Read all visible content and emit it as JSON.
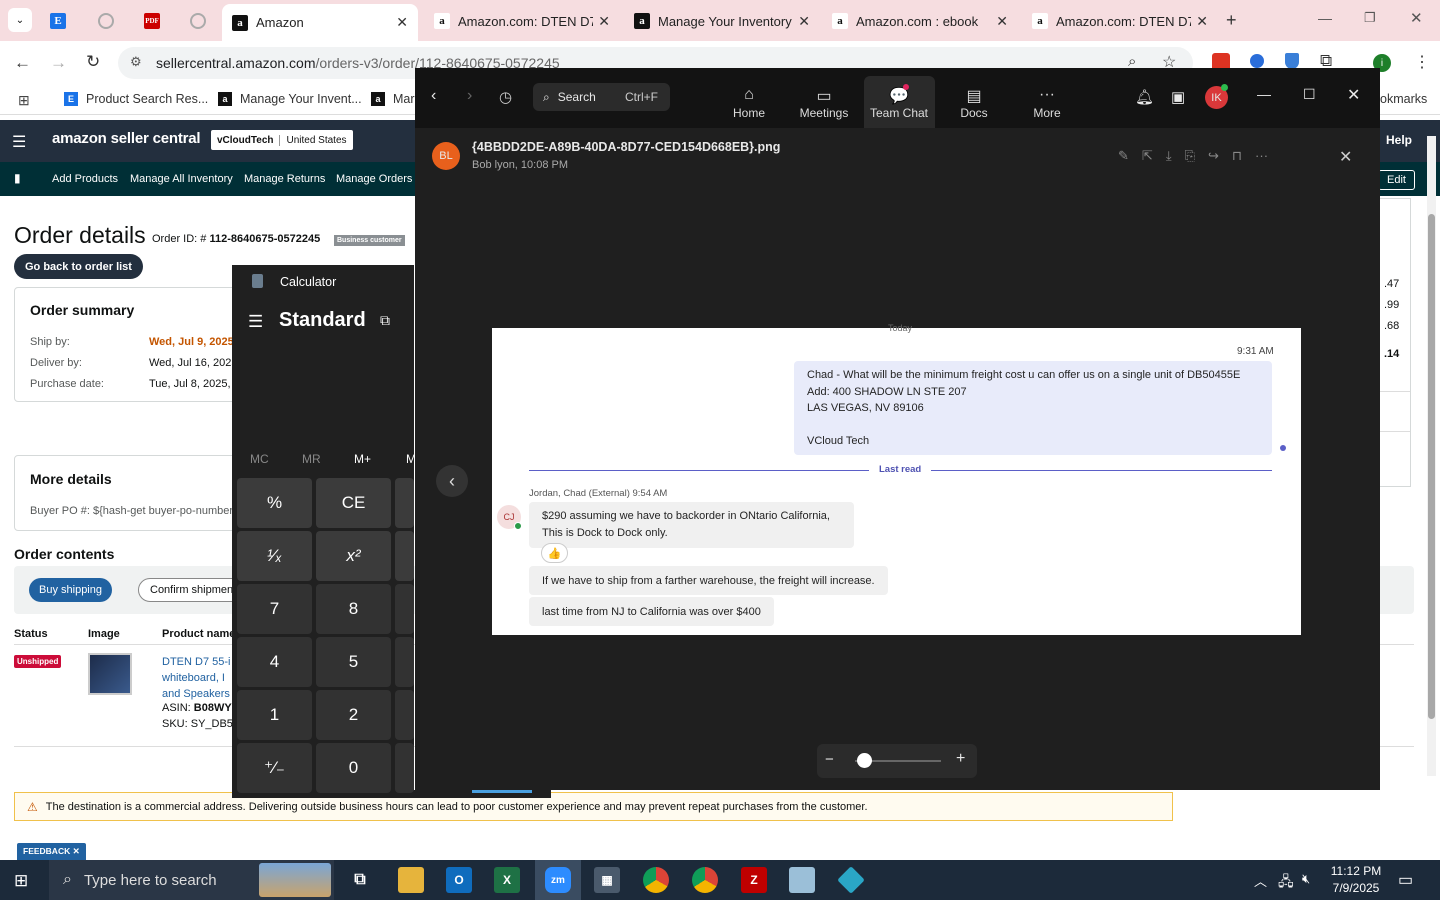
{
  "tabs": [
    {
      "label": "",
      "icon": "ec-icon"
    },
    {
      "label": "",
      "icon": "globe-icon"
    },
    {
      "label": "",
      "icon": "pdf-icon"
    },
    {
      "label": "",
      "icon": "globe-icon"
    },
    {
      "label": "Amazon",
      "icon": "amazon-icon"
    },
    {
      "label": "Amazon.com: DTEN D7 5",
      "icon": "amazon-icon"
    },
    {
      "label": "Manage Your Inventory",
      "icon": "amazon-icon"
    },
    {
      "label": "Amazon.com : ebook",
      "icon": "amazon-icon"
    },
    {
      "label": "Amazon.com: DTEN D7 5",
      "icon": "amazon-icon"
    }
  ],
  "address": {
    "host": "sellercentral.amazon.com",
    "path": "/orders-v3/order/112-8640675-0572245"
  },
  "bookmarks": [
    {
      "label": "Product Search Res..."
    },
    {
      "label": "Manage Your Invent..."
    },
    {
      "label": "Mar"
    },
    {
      "label": "okmarks"
    }
  ],
  "seller": {
    "logo": "amazon seller central",
    "account": "vCloudTech",
    "marketplace": "United States",
    "help": "Help",
    "edit": "Edit",
    "nav": [
      "Add Products",
      "Manage All Inventory",
      "Manage Returns",
      "Manage Orders"
    ],
    "order_title": "Order details",
    "order_id_label": "Order ID: #",
    "order_id": "112-8640675-0572245",
    "business_badge": "Business customer",
    "back_button": "Go back to order list",
    "summary_title": "Order summary",
    "ship_by_label": "Ship by:",
    "ship_by": "Wed, Jul 9, 2025",
    "deliver_by_label": "Deliver by:",
    "deliver_by": "Wed, Jul 16, 2025",
    "purchase_label": "Purchase date:",
    "purchase": "Tue, Jul 8, 2025,",
    "more_title": "More details",
    "buyer_po": "Buyer PO #: ${hash-get buyer-po-number}",
    "contents_title": "Order contents",
    "buy_shipping": "Buy shipping",
    "confirm_shipment": "Confirm shipment",
    "col_status": "Status",
    "col_image": "Image",
    "col_product": "Product name",
    "status_badge": "Unshipped",
    "product_line1": "DTEN D7 55-i",
    "product_line2": "whiteboard, I",
    "product_line3": "and Speakers",
    "asin_label": "ASIN:",
    "asin": "B08WY",
    "sku": "SKU: SY_DB50",
    "right_values": [
      ".47",
      ".99",
      ".68",
      ".14"
    ],
    "warning": "The destination is a commercial address. Delivering outside business hours can lead to poor customer experience and may prevent repeat purchases from the customer.",
    "feedback": "FEEDBACK ✕"
  },
  "calculator": {
    "title": "Calculator",
    "mode": "Standard",
    "memory": [
      "MC",
      "MR",
      "M+",
      "M"
    ],
    "keys": [
      [
        "%",
        "CE"
      ],
      [
        "¹⁄ₓ",
        "x²"
      ],
      [
        "7",
        "8"
      ],
      [
        "4",
        "5"
      ],
      [
        "1",
        "2"
      ],
      [
        "⁺⁄₋",
        "0"
      ]
    ]
  },
  "zoom": {
    "search_placeholder": "Search",
    "search_shortcut": "Ctrl+F",
    "nav": [
      {
        "label": "Home",
        "icon": "home-icon"
      },
      {
        "label": "Meetings",
        "icon": "video-icon"
      },
      {
        "label": "Team Chat",
        "icon": "chat-icon"
      },
      {
        "label": "Docs",
        "icon": "docs-icon"
      },
      {
        "label": "More",
        "icon": "more-icon"
      }
    ],
    "avatar_initials": "IK",
    "file_name": "{4BBDD2DE-A89B-40DA-8D77-CED154D668EB}.png",
    "file_meta": "Bob lyon, 10:08 PM",
    "sender_initials": "BL",
    "image": {
      "today": "Today",
      "time1": "9:31 AM",
      "msg_lines": [
        "Chad -  What will be the minimum freight cost u can offer us on a single unit of DB50455E",
        "Add: 400 SHADOW LN STE 207",
        "LAS VEGAS, NV 89106",
        "",
        "VCloud Tech"
      ],
      "last_read": "Last read",
      "reply_header": "Jordan, Chad (External)  9:54 AM",
      "reply_initials": "CJ",
      "reply1": [
        "$290 assuming we have to backorder in ONtario California,",
        "This is Dock to Dock only."
      ],
      "reaction": "👍",
      "reply2": "If we have to ship from a farther warehouse, the freight will increase.",
      "reply3": "last time from NJ to California was over $400"
    },
    "zoom_level": 0.1
  },
  "taskbar": {
    "search_placeholder": "Type here to search",
    "time": "11:12 PM",
    "date": "7/9/2025"
  }
}
